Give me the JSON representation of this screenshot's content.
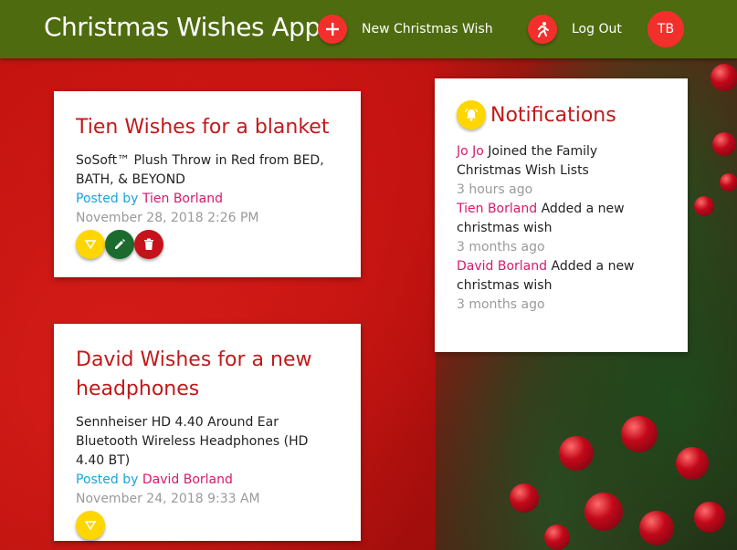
{
  "topbar": {
    "title": "Christmas Wishes App",
    "new_wish_label": "New Christmas Wish",
    "logout_label": "Log Out",
    "avatar_initials": "TB"
  },
  "wishes": [
    {
      "title": "Tien Wishes for a blanket",
      "description": "SoSoft™ Plush Throw in Red from BED, BATH, & BEYOND",
      "posted_by_label": "Posted by",
      "author": "Tien Borland",
      "date": "November 28, 2018 2:26 PM"
    },
    {
      "title": "David Wishes for a new headphones",
      "description": "Sennheiser HD 4.40 Around Ear Bluetooth Wireless Headphones (HD 4.40 BT)",
      "posted_by_label": "Posted by",
      "author": "David Borland",
      "date": "November 24, 2018 9:33 AM"
    }
  ],
  "notifications": {
    "title": "Notifications",
    "items": [
      {
        "who": "Jo Jo",
        "text": "Joined the Family Christmas Wish Lists",
        "time": "3 hours ago"
      },
      {
        "who": "Tien Borland",
        "text": "Added a new christmas wish",
        "time": "3 months ago"
      },
      {
        "who": "David Borland",
        "text": "Added a new christmas wish",
        "time": "3 months ago"
      }
    ]
  },
  "colors": {
    "topbar": "#4e6b10",
    "accent_red": "#c2191a",
    "fab_red": "#f32f2c",
    "author_pink": "#d8196b",
    "posted_blue": "#1aa3dc",
    "icon_yellow": "#ffd600",
    "edit_green": "#1c6b2e"
  },
  "icons": {
    "add": "plus-icon",
    "logout": "running-person-icon",
    "like": "triangle-down-icon",
    "edit": "pencil-icon",
    "delete": "trash-icon",
    "notifications": "bell-icon"
  }
}
